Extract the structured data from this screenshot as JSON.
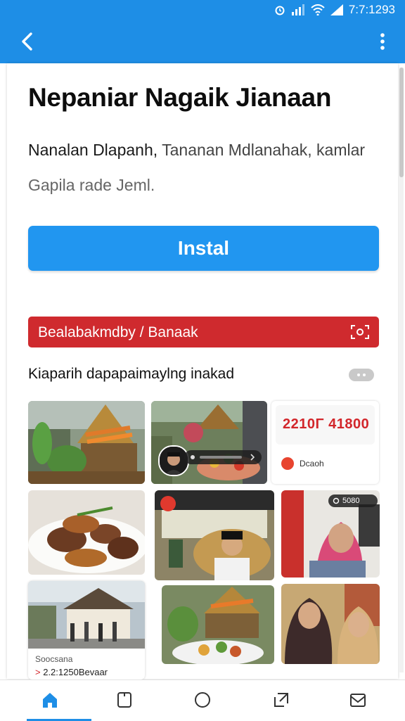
{
  "status_bar": {
    "time": "7:7:1293"
  },
  "app_bar": {
    "back_icon": "back-arrow-icon",
    "menu_icon": "more-vert-icon"
  },
  "app": {
    "title": "Nepaniar Nagaik Jianaan",
    "description_line1_a": "Nanalan Dlapanh,",
    "description_line1_b": " Tananan Mdlanahak, kamlar",
    "description_line2": "Gapila rade Jeml.",
    "install_label": "Instal"
  },
  "banner": {
    "label": "Bealabakmdby / Banaak",
    "icon": "scan-icon"
  },
  "section": {
    "title": "Kiaparih dapapaimaylng inakad",
    "more_icon": "more-horiz-icon"
  },
  "promo": {
    "value": "2210Γ 41800",
    "subtitle": "Dcaoh"
  },
  "tag": {
    "label": "5080"
  },
  "news": {
    "name": "Soocsana",
    "price": "2.2:1250Bevaar"
  },
  "bottom_nav": [
    {
      "name": "home",
      "icon": "home-icon"
    },
    {
      "name": "library",
      "icon": "tablet-icon"
    },
    {
      "name": "circle",
      "icon": "circle-icon"
    },
    {
      "name": "share",
      "icon": "share-icon"
    },
    {
      "name": "mail",
      "icon": "mail-icon"
    }
  ],
  "colors": {
    "accent": "#1e8ee6",
    "button": "#2196f0",
    "banner": "#cf2a2e",
    "price": "#d2262b"
  }
}
